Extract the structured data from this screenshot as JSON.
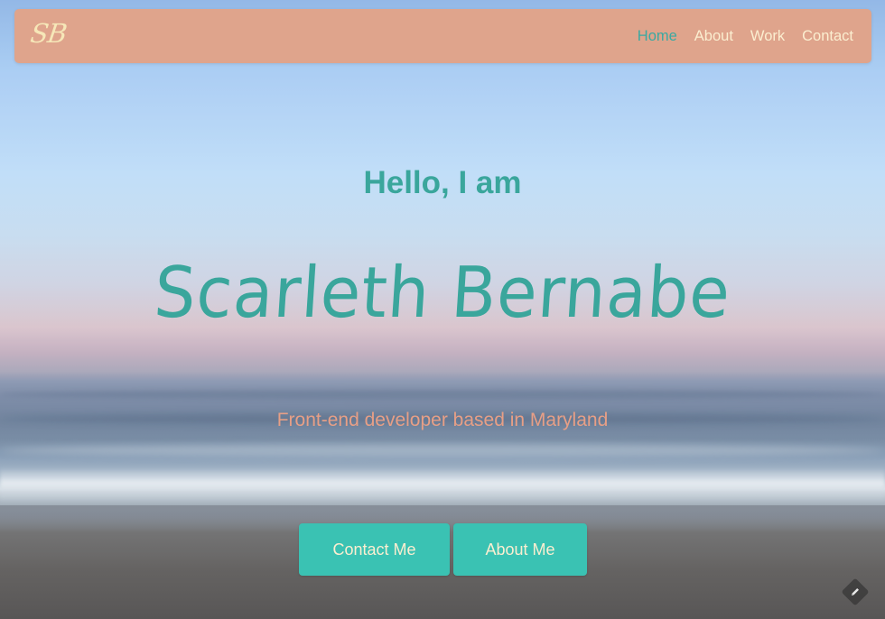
{
  "navbar": {
    "brand": "SB",
    "links": [
      {
        "label": "Home",
        "active": true
      },
      {
        "label": "About",
        "active": false
      },
      {
        "label": "Work",
        "active": false
      },
      {
        "label": "Contact",
        "active": false
      }
    ]
  },
  "hero": {
    "greeting": "Hello, I am",
    "name": "Scarleth Bernabe",
    "tagline": "Front-end developer based in Maryland",
    "buttons": {
      "contact": "Contact Me",
      "about": "About Me"
    }
  },
  "icons": {
    "edit": "pencil-edit-icon"
  },
  "colors": {
    "navbar_bg": "#dfa48c",
    "accent_teal": "#3aa69c",
    "button_bg": "#3ac2b3",
    "cream_text": "#fbeed0",
    "tagline": "#e79f86"
  }
}
